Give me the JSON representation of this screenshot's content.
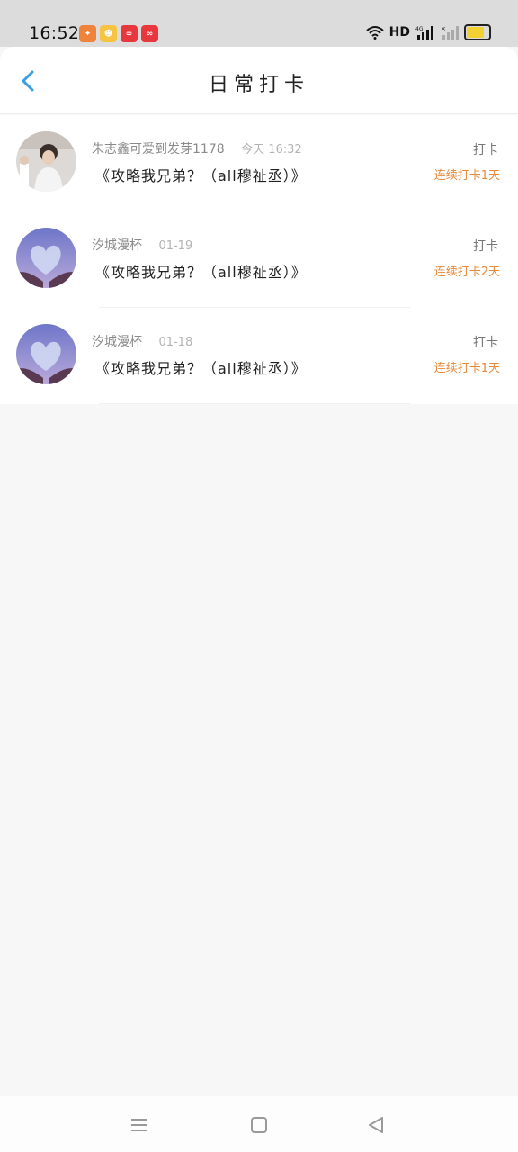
{
  "status_bar": {
    "time": "16:52",
    "network_label": "HD",
    "notifications": [
      {
        "icon": "app-notification-icon-1",
        "color": "#f0833c"
      },
      {
        "icon": "app-notification-icon-2",
        "color": "#f6c343"
      },
      {
        "icon": "app-notification-icon-3",
        "color": "#e8383d"
      },
      {
        "icon": "app-notification-icon-4",
        "color": "#e8383d"
      }
    ],
    "battery_color": "#f2d233"
  },
  "header": {
    "title": "日常打卡",
    "back_icon": "chevron-left-icon",
    "accent_color": "#3a9ee4"
  },
  "items": [
    {
      "user": "朱志鑫可爱到发芽1178",
      "date": "今天 16:32",
      "title": "《攻略我兄弟？（all穆祉丞）》",
      "type": "打卡",
      "streak": "连续打卡1天"
    },
    {
      "user": "汐城漫杯",
      "date": "01-19",
      "title": "《攻略我兄弟？（all穆祉丞）》",
      "type": "打卡",
      "streak": "连续打卡2天"
    },
    {
      "user": "汐城漫杯",
      "date": "01-18",
      "title": "《攻略我兄弟？（all穆祉丞）》",
      "type": "打卡",
      "streak": "连续打卡1天"
    }
  ],
  "nav": {
    "menu_icon": "menu-icon",
    "home_icon": "home-square-icon",
    "back_icon": "back-triangle-icon"
  }
}
